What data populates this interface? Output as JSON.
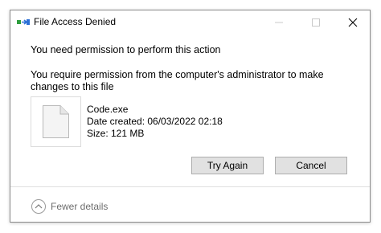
{
  "window": {
    "title": "File Access Denied",
    "icon": "folder-arrow-icon"
  },
  "message": {
    "main": "You need permission to perform this action",
    "detail": "You require permission from the computer's administrator to make changes to this file"
  },
  "file": {
    "icon": "file-icon",
    "name": "Code.exe",
    "date_created": "Date created: 06/03/2022 02:18",
    "size": "Size: 121 MB"
  },
  "buttons": {
    "try_again": "Try Again",
    "cancel": "Cancel"
  },
  "details": {
    "label": "Fewer details",
    "icon": "chevron-up-icon"
  },
  "colors": {
    "accent_green": "#2e9e3e",
    "accent_blue": "#2a6fd6",
    "button_face": "#e1e1e1",
    "button_border": "#adadad"
  }
}
